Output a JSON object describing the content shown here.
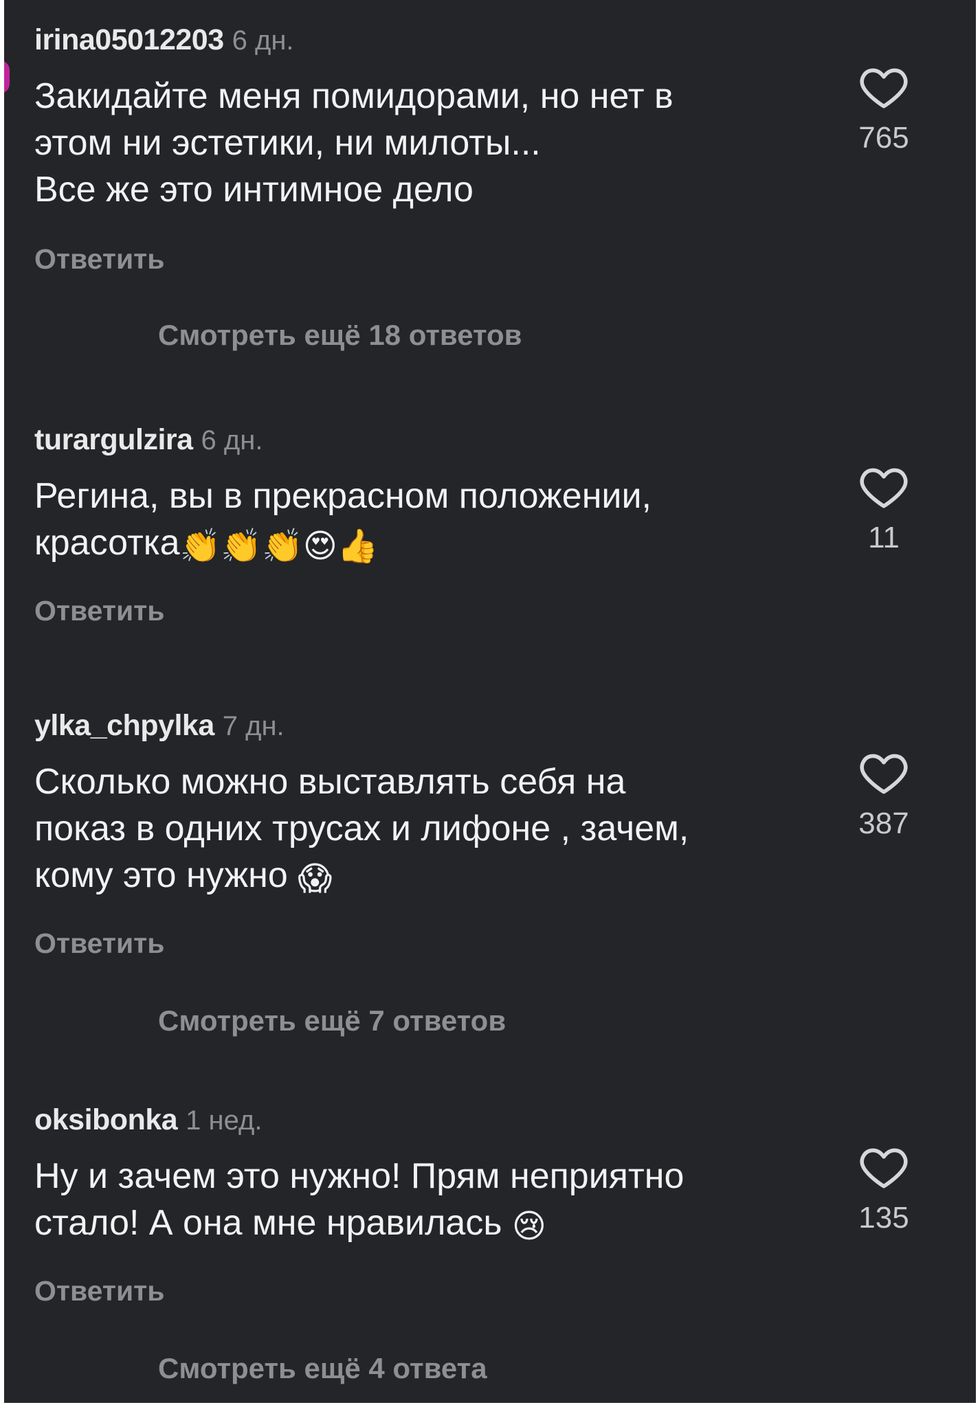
{
  "comments": [
    {
      "username": "irina05012203",
      "time": "6 дн.",
      "lines": [
        "Закидайте меня помидорами, но нет в",
        "этом ни эстетики, ни милоты...",
        "Все же это интимное дело"
      ],
      "emoji": "",
      "likes": "765",
      "reply_label": "Ответить",
      "view_more": "Смотреть ещё 18 ответов"
    },
    {
      "username": "turargulzira",
      "time": "6 дн.",
      "lines": [
        "Регина, вы в прекрасном положении,",
        "красотка"
      ],
      "emoji": "👏👏👏😍👍",
      "likes": "11",
      "reply_label": "Ответить",
      "view_more": ""
    },
    {
      "username": "ylka_chpylka",
      "time": "7 дн.",
      "lines": [
        "Сколько можно выставлять себя на",
        "показ в одних трусах и лифоне , зачем,",
        "кому это нужно"
      ],
      "emoji": "😱",
      "likes": "387",
      "reply_label": "Ответить",
      "view_more": "Смотреть ещё 7 ответов"
    },
    {
      "username": "oksibonka",
      "time": "1 нед.",
      "lines": [
        "Ну и зачем это нужно! Прям неприятно",
        "стало! А она мне нравилась"
      ],
      "emoji": "😢",
      "likes": "135",
      "reply_label": "Ответить",
      "view_more": "Смотреть ещё 4 ответа"
    }
  ],
  "icons": {
    "like": "heart-outline-icon"
  },
  "colors": {
    "background": "#232529",
    "text": "#f2f2f3",
    "muted": "#8d8f93"
  }
}
